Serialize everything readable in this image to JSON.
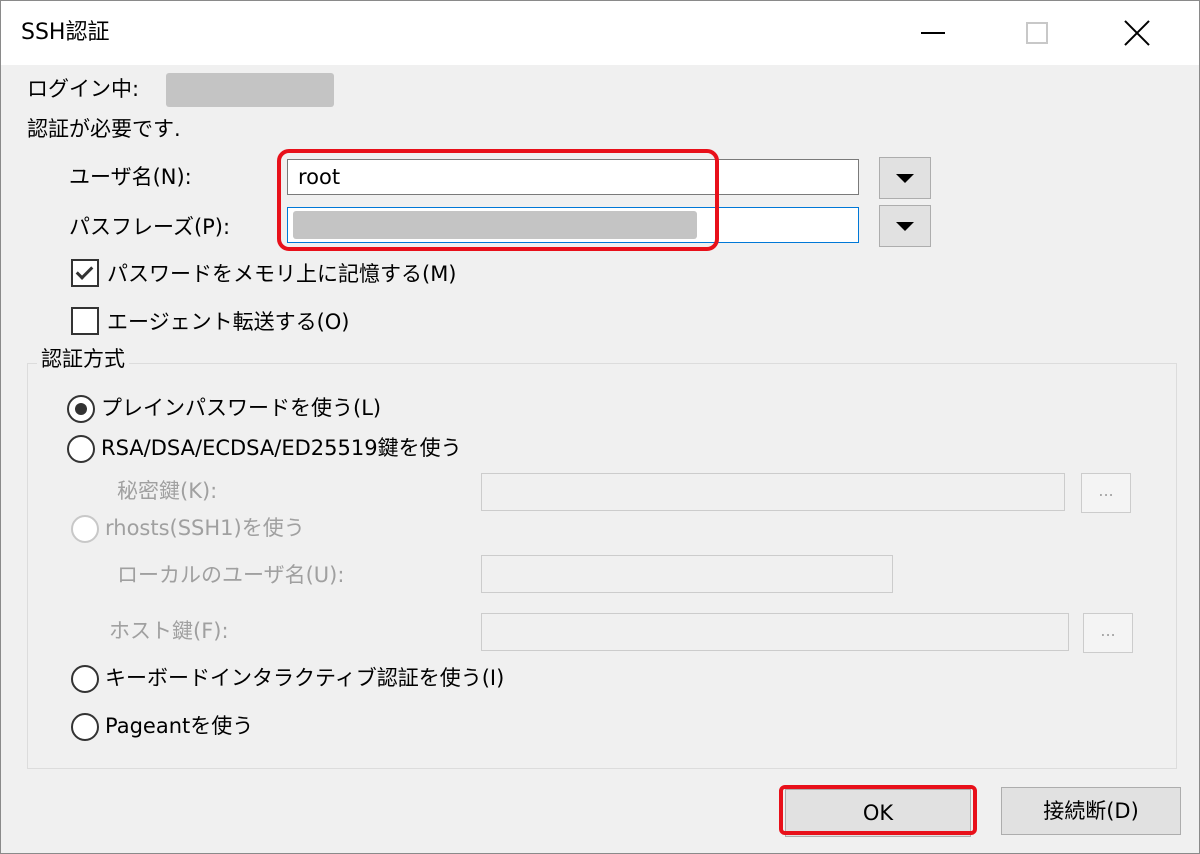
{
  "window": {
    "title": "SSH認証",
    "min_icon": "minimize-icon",
    "max_icon": "maximize-icon",
    "close_icon": "close-icon"
  },
  "login_label": "ログイン中:",
  "auth_required": "認証が必要です.",
  "username": {
    "label": "ユーザ名(N):",
    "value": "root"
  },
  "passphrase": {
    "label": "パスフレーズ(P):"
  },
  "remember_password": {
    "label": "パスワードをメモリ上に記憶する(M)",
    "checked": true
  },
  "agent_forward": {
    "label": "エージェント転送する(O)",
    "checked": false
  },
  "auth_method": {
    "legend": "認証方式",
    "options": [
      {
        "label": "プレインパスワードを使う(L)",
        "selected": true
      },
      {
        "label": "RSA/DSA/ECDSA/ED25519鍵を使う",
        "selected": false
      },
      {
        "label": "rhosts(SSH1)を使う",
        "selected": false,
        "disabled": true
      },
      {
        "label": "キーボードインタラクティブ認証を使う(I)",
        "selected": false
      },
      {
        "label": "Pageantを使う",
        "selected": false
      }
    ],
    "private_key_label": "秘密鍵(K):",
    "local_user_label": "ローカルのユーザ名(U):",
    "host_key_label": "ホスト鍵(F):",
    "browse_label": "..."
  },
  "buttons": {
    "ok": "OK",
    "disconnect": "接続断(D)"
  },
  "colors": {
    "highlight": "#e8101a",
    "focus_border": "#0078d7"
  }
}
